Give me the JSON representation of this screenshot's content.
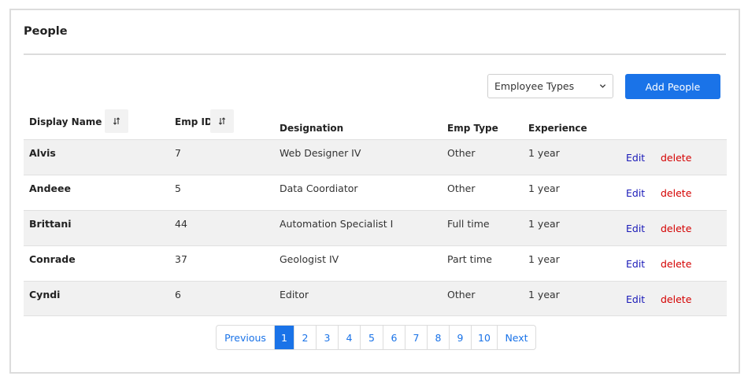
{
  "header": {
    "title": "People"
  },
  "toolbar": {
    "employee_types_label": "Employee Types",
    "add_people_label": "Add People"
  },
  "table": {
    "columns": {
      "display_name": "Display Name",
      "emp_id": "Emp ID",
      "designation": "Designation",
      "emp_type": "Emp Type",
      "experience": "Experience"
    },
    "rows": [
      {
        "name": "Alvis",
        "id": "7",
        "designation": "Web Designer IV",
        "type": "Other",
        "experience": "1 year",
        "edit": "Edit",
        "delete": "delete"
      },
      {
        "name": "Andeee",
        "id": "5",
        "designation": "Data Coordiator",
        "type": "Other",
        "experience": "1 year",
        "edit": "Edit",
        "delete": "delete"
      },
      {
        "name": "Brittani",
        "id": "44",
        "designation": "Automation Specialist I",
        "type": "Full time",
        "experience": "1 year",
        "edit": "Edit",
        "delete": "delete"
      },
      {
        "name": "Conrade",
        "id": "37",
        "designation": "Geologist IV",
        "type": "Part time",
        "experience": "1 year",
        "edit": "Edit",
        "delete": "delete"
      },
      {
        "name": "Cyndi",
        "id": "6",
        "designation": "Editor",
        "type": "Other",
        "experience": "1 year",
        "edit": "Edit",
        "delete": "delete"
      }
    ]
  },
  "pagination": {
    "previous": "Previous",
    "pages": [
      "1",
      "2",
      "3",
      "4",
      "5",
      "6",
      "7",
      "8",
      "9",
      "10"
    ],
    "current": "1",
    "next": "Next"
  },
  "colors": {
    "accent": "#1a73e8",
    "edit": "#1a1ab8",
    "delete": "#d40000"
  },
  "icons": {
    "sort": "sort-arrows-icon",
    "dropdown": "chevron-down-icon"
  }
}
